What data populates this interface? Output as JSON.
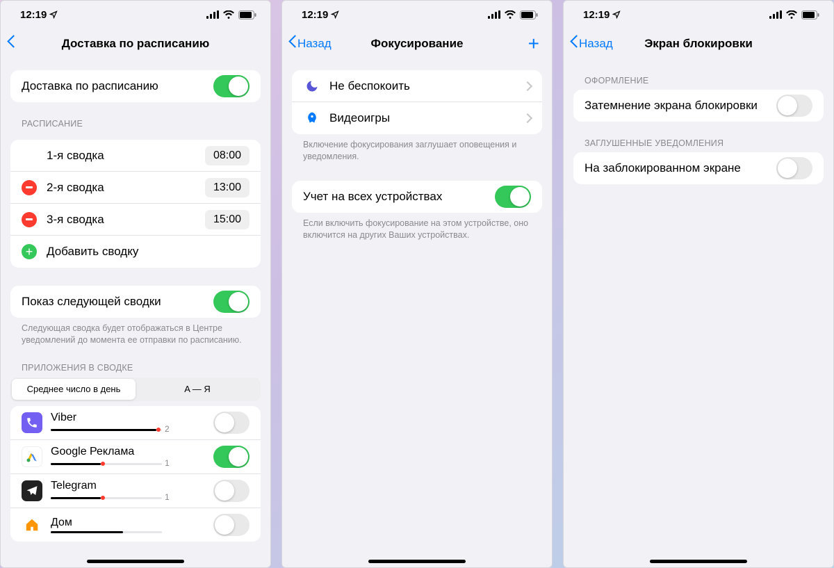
{
  "status": {
    "time": "12:19"
  },
  "screen1": {
    "title": "Доставка по расписанию",
    "main_toggle_label": "Доставка по расписанию",
    "schedule_header": "РАСПИСАНИЕ",
    "summaries": [
      {
        "label": "1-я сводка",
        "time": "08:00",
        "removable": false
      },
      {
        "label": "2-я сводка",
        "time": "13:00",
        "removable": true
      },
      {
        "label": "3-я сводка",
        "time": "15:00",
        "removable": true
      }
    ],
    "add_label": "Добавить сводку",
    "next_summary_label": "Показ следующей сводки",
    "next_summary_footer": "Следующая сводка будет отображаться в Центре уведомлений до момента ее отправки по расписанию.",
    "apps_header": "ПРИЛОЖЕНИЯ В СВОДКЕ",
    "segmented": {
      "opt1": "Среднее число в день",
      "opt2": "A — Я"
    },
    "apps": [
      {
        "name": "Viber",
        "count": "2",
        "on": false,
        "bar": 95,
        "dot": 95
      },
      {
        "name": "Google Реклама",
        "count": "1",
        "on": true,
        "bar": 45,
        "dot": 45
      },
      {
        "name": "Telegram",
        "count": "1",
        "on": false,
        "bar": 45,
        "dot": 45
      },
      {
        "name": "Дом",
        "count": "",
        "on": false,
        "bar": 65,
        "dot": -1
      }
    ]
  },
  "screen2": {
    "back": "Назад",
    "title": "Фокусирование",
    "items": [
      {
        "label": "Не беспокоить"
      },
      {
        "label": "Видеоигры"
      }
    ],
    "footer1": "Включение фокусирования заглушает оповещения и уведомления.",
    "share_label": "Учет на всех устройствах",
    "footer2": "Если включить фокусирование на этом устройстве, оно включится на других Ваших устройствах."
  },
  "screen3": {
    "back": "Назад",
    "title": "Экран блокировки",
    "header1": "ОФОРМЛЕНИЕ",
    "row1": "Затемнение экрана блокировки",
    "header2": "ЗАГЛУШЕННЫЕ УВЕДОМЛЕНИЯ",
    "row2": "На заблокированном экране"
  }
}
